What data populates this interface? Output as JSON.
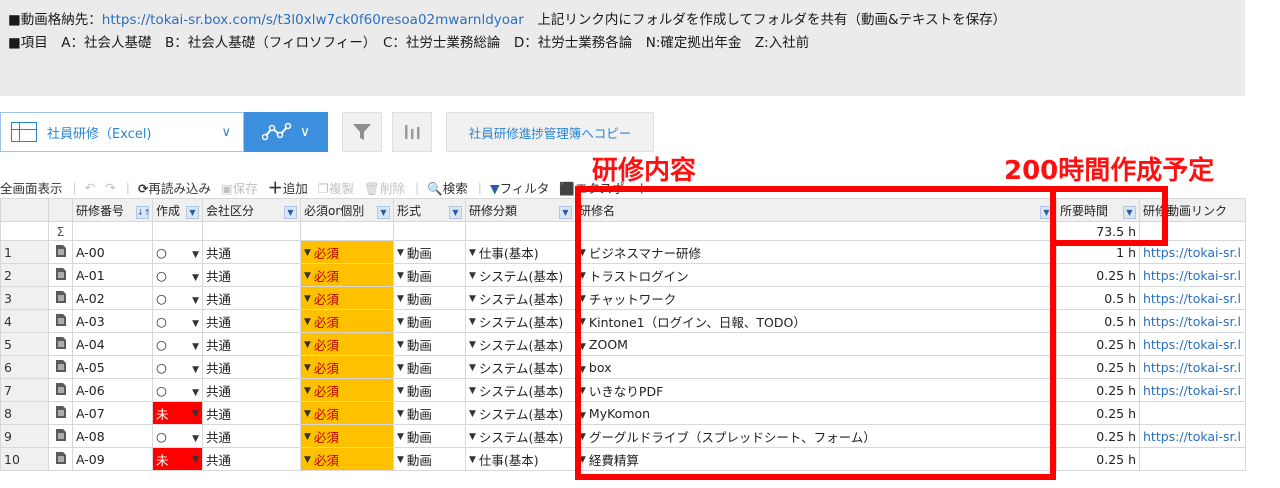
{
  "info": {
    "line1_prefix": "■動画格納先：",
    "line1_link": "https://tokai-sr.box.com/s/t3l0xlw7ck0f60resoa02mwarnldyoar",
    "line1_suffix": "　上記リンク内にフォルダを作成してフォルダを共有（動画&テキストを保存）",
    "line2": "■項目　A：社会人基礎　B：社会人基礎（フィロソフィー）　C：社労士業務総論　D：社労士業務各論　N:確定拠出年金　Z:入社前"
  },
  "toolbar": {
    "view_name": "社員研修（Excel)",
    "view_chevron": "∨",
    "graph_chevron": "∨",
    "copy_label": "社員研修進捗管理簿へコピー",
    "fullscreen": "全画面表示",
    "undo": "↶",
    "redo": "↷",
    "reload": "再読み込み",
    "save": "保存",
    "add": "追加",
    "duplicate": "複製",
    "delete": "削除",
    "search": "検索",
    "filter": "フィルタ",
    "export": "エクスポート"
  },
  "annotations": {
    "content": "研修内容",
    "plan": "200時間作成予定"
  },
  "sum_symbol": "Σ",
  "grid": {
    "headers": [
      "研修番号",
      "作成",
      "会社区分",
      "必須or個別",
      "形式",
      "研修分類",
      "研修名",
      "所要時間",
      "研修動画リンク"
    ],
    "total_hours": "73.5 h",
    "rows": [
      {
        "no": "1",
        "id": "A-00",
        "made": "○",
        "company": "共通",
        "req": "必須",
        "format": "動画",
        "cat": "仕事(基本)",
        "name": "ビジネスマナー研修",
        "hours": "1 h",
        "link": "https://tokai-sr.l"
      },
      {
        "no": "2",
        "id": "A-01",
        "made": "○",
        "company": "共通",
        "req": "必須",
        "format": "動画",
        "cat": "システム(基本)",
        "name": "トラストログイン",
        "hours": "0.25 h",
        "link": "https://tokai-sr.l"
      },
      {
        "no": "3",
        "id": "A-02",
        "made": "○",
        "company": "共通",
        "req": "必須",
        "format": "動画",
        "cat": "システム(基本)",
        "name": "チャットワーク",
        "hours": "0.5 h",
        "link": "https://tokai-sr.l"
      },
      {
        "no": "4",
        "id": "A-03",
        "made": "○",
        "company": "共通",
        "req": "必須",
        "format": "動画",
        "cat": "システム(基本)",
        "name": "Kintone1（ログイン、日報、TODO）",
        "hours": "0.5 h",
        "link": "https://tokai-sr.l"
      },
      {
        "no": "5",
        "id": "A-04",
        "made": "○",
        "company": "共通",
        "req": "必須",
        "format": "動画",
        "cat": "システム(基本)",
        "name": "ZOOM",
        "hours": "0.25 h",
        "link": "https://tokai-sr.l"
      },
      {
        "no": "6",
        "id": "A-05",
        "made": "○",
        "company": "共通",
        "req": "必須",
        "format": "動画",
        "cat": "システム(基本)",
        "name": "box",
        "hours": "0.25 h",
        "link": "https://tokai-sr.l"
      },
      {
        "no": "7",
        "id": "A-06",
        "made": "○",
        "company": "共通",
        "req": "必須",
        "format": "動画",
        "cat": "システム(基本)",
        "name": "いきなりPDF",
        "hours": "0.25 h",
        "link": "https://tokai-sr.l"
      },
      {
        "no": "8",
        "id": "A-07",
        "made": "未",
        "company": "共通",
        "req": "必須",
        "format": "動画",
        "cat": "システム(基本)",
        "name": "MyKomon",
        "hours": "0.25 h",
        "link": ""
      },
      {
        "no": "9",
        "id": "A-08",
        "made": "○",
        "company": "共通",
        "req": "必須",
        "format": "動画",
        "cat": "システム(基本)",
        "name": "グーグルドライブ（スプレッドシート、フォーム）",
        "hours": "0.25 h",
        "link": "https://tokai-sr.l"
      },
      {
        "no": "10",
        "id": "A-09",
        "made": "未",
        "company": "共通",
        "req": "必須",
        "format": "動画",
        "cat": "仕事(基本)",
        "name": "経費精算",
        "hours": "0.25 h",
        "link": ""
      }
    ]
  },
  "colors": {
    "required_bg": "#ffc000",
    "required_text": "#c00000",
    "not_made_bg": "#ff0000",
    "annotation_red": "#ff0000",
    "link_blue": "#2a6fbe"
  }
}
